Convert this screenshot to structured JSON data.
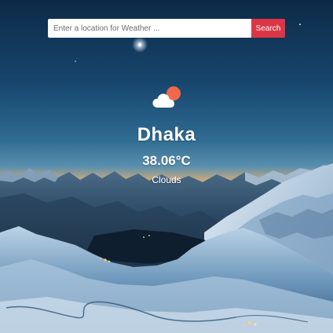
{
  "search": {
    "placeholder": "Enter a location for Weather ...",
    "value": "",
    "button_label": "Search"
  },
  "weather": {
    "icon": "cloud-sun-icon",
    "city": "Dhaka",
    "temperature": "38.06°C",
    "condition": "Clouds"
  },
  "colors": {
    "search_button": "#dc3545",
    "sky_top": "#0d2f4f",
    "sky_horizon": "#4d86a8",
    "sunset_glow": "#f2b46a",
    "snow": "#cfe2f0",
    "sun_icon": "#f2684a"
  }
}
